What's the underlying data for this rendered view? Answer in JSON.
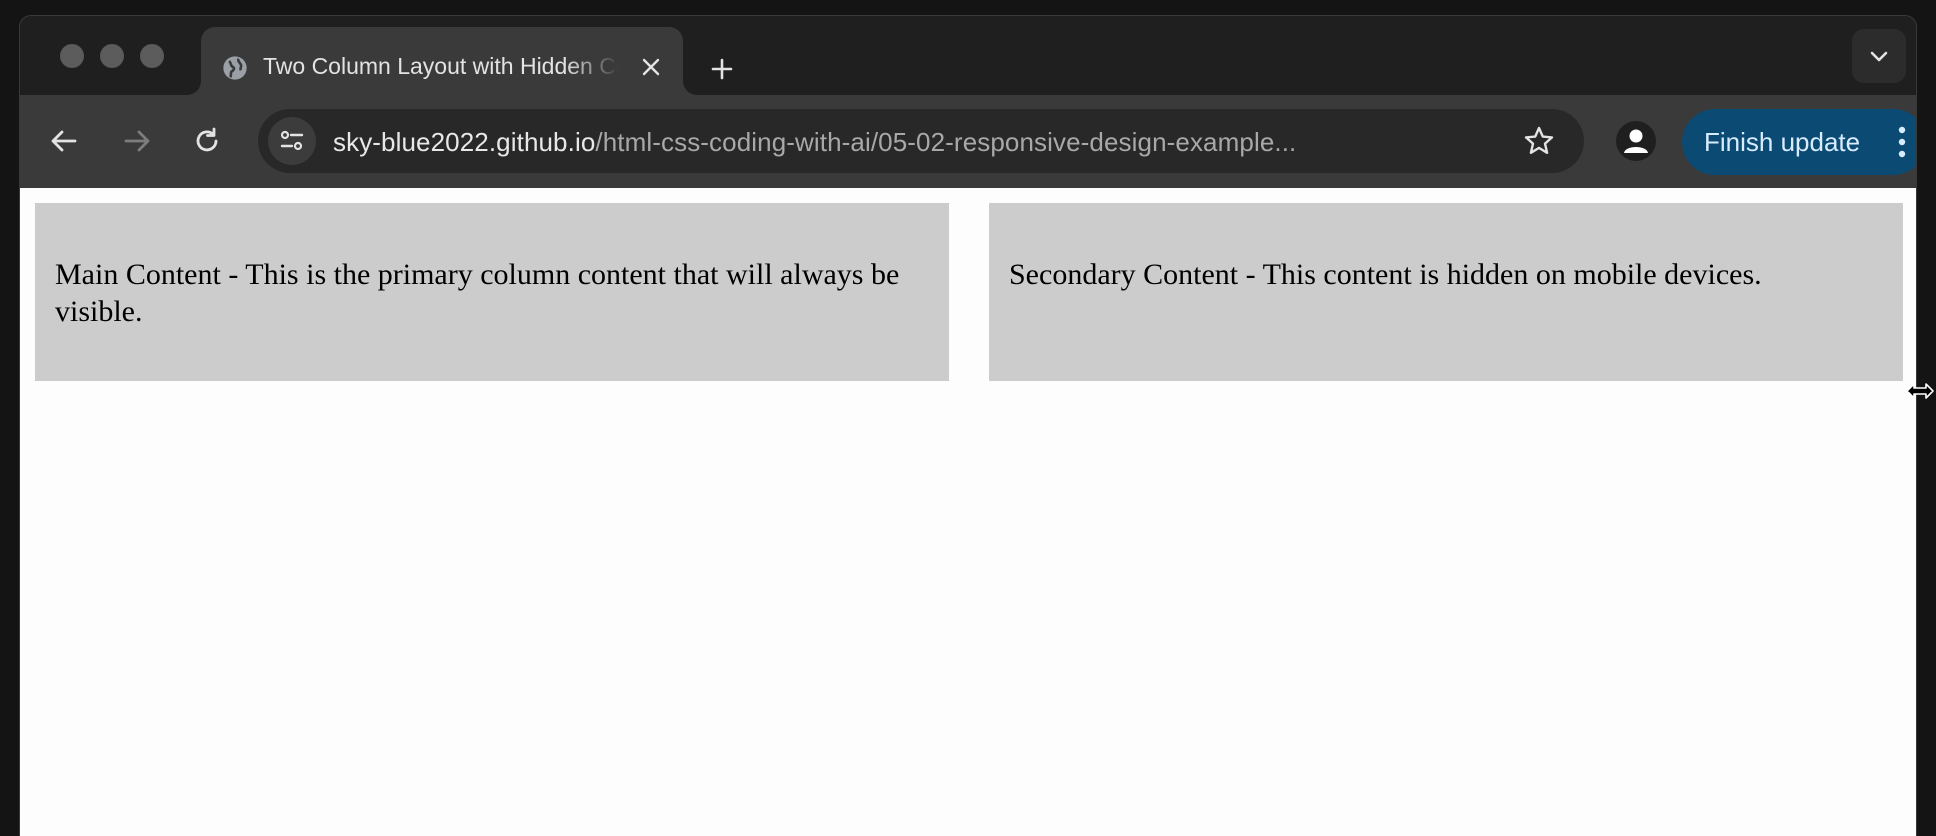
{
  "browser": {
    "tab": {
      "title": "Two Column Layout with Hidden Content",
      "favicon": "globe-icon"
    },
    "address_bar": {
      "host": "sky-blue2022.github.io",
      "path": "/html-css-coding-with-ai/05-02-responsive-design-example..."
    },
    "finish_update_label": "Finish update",
    "accent_color": "#0b4a73"
  },
  "page": {
    "main_content": "Main Content - This is the primary column content that will always be visible.",
    "secondary_content": "Secondary Content - This content is hidden on mobile devices.",
    "column_background": "#cccccc"
  }
}
